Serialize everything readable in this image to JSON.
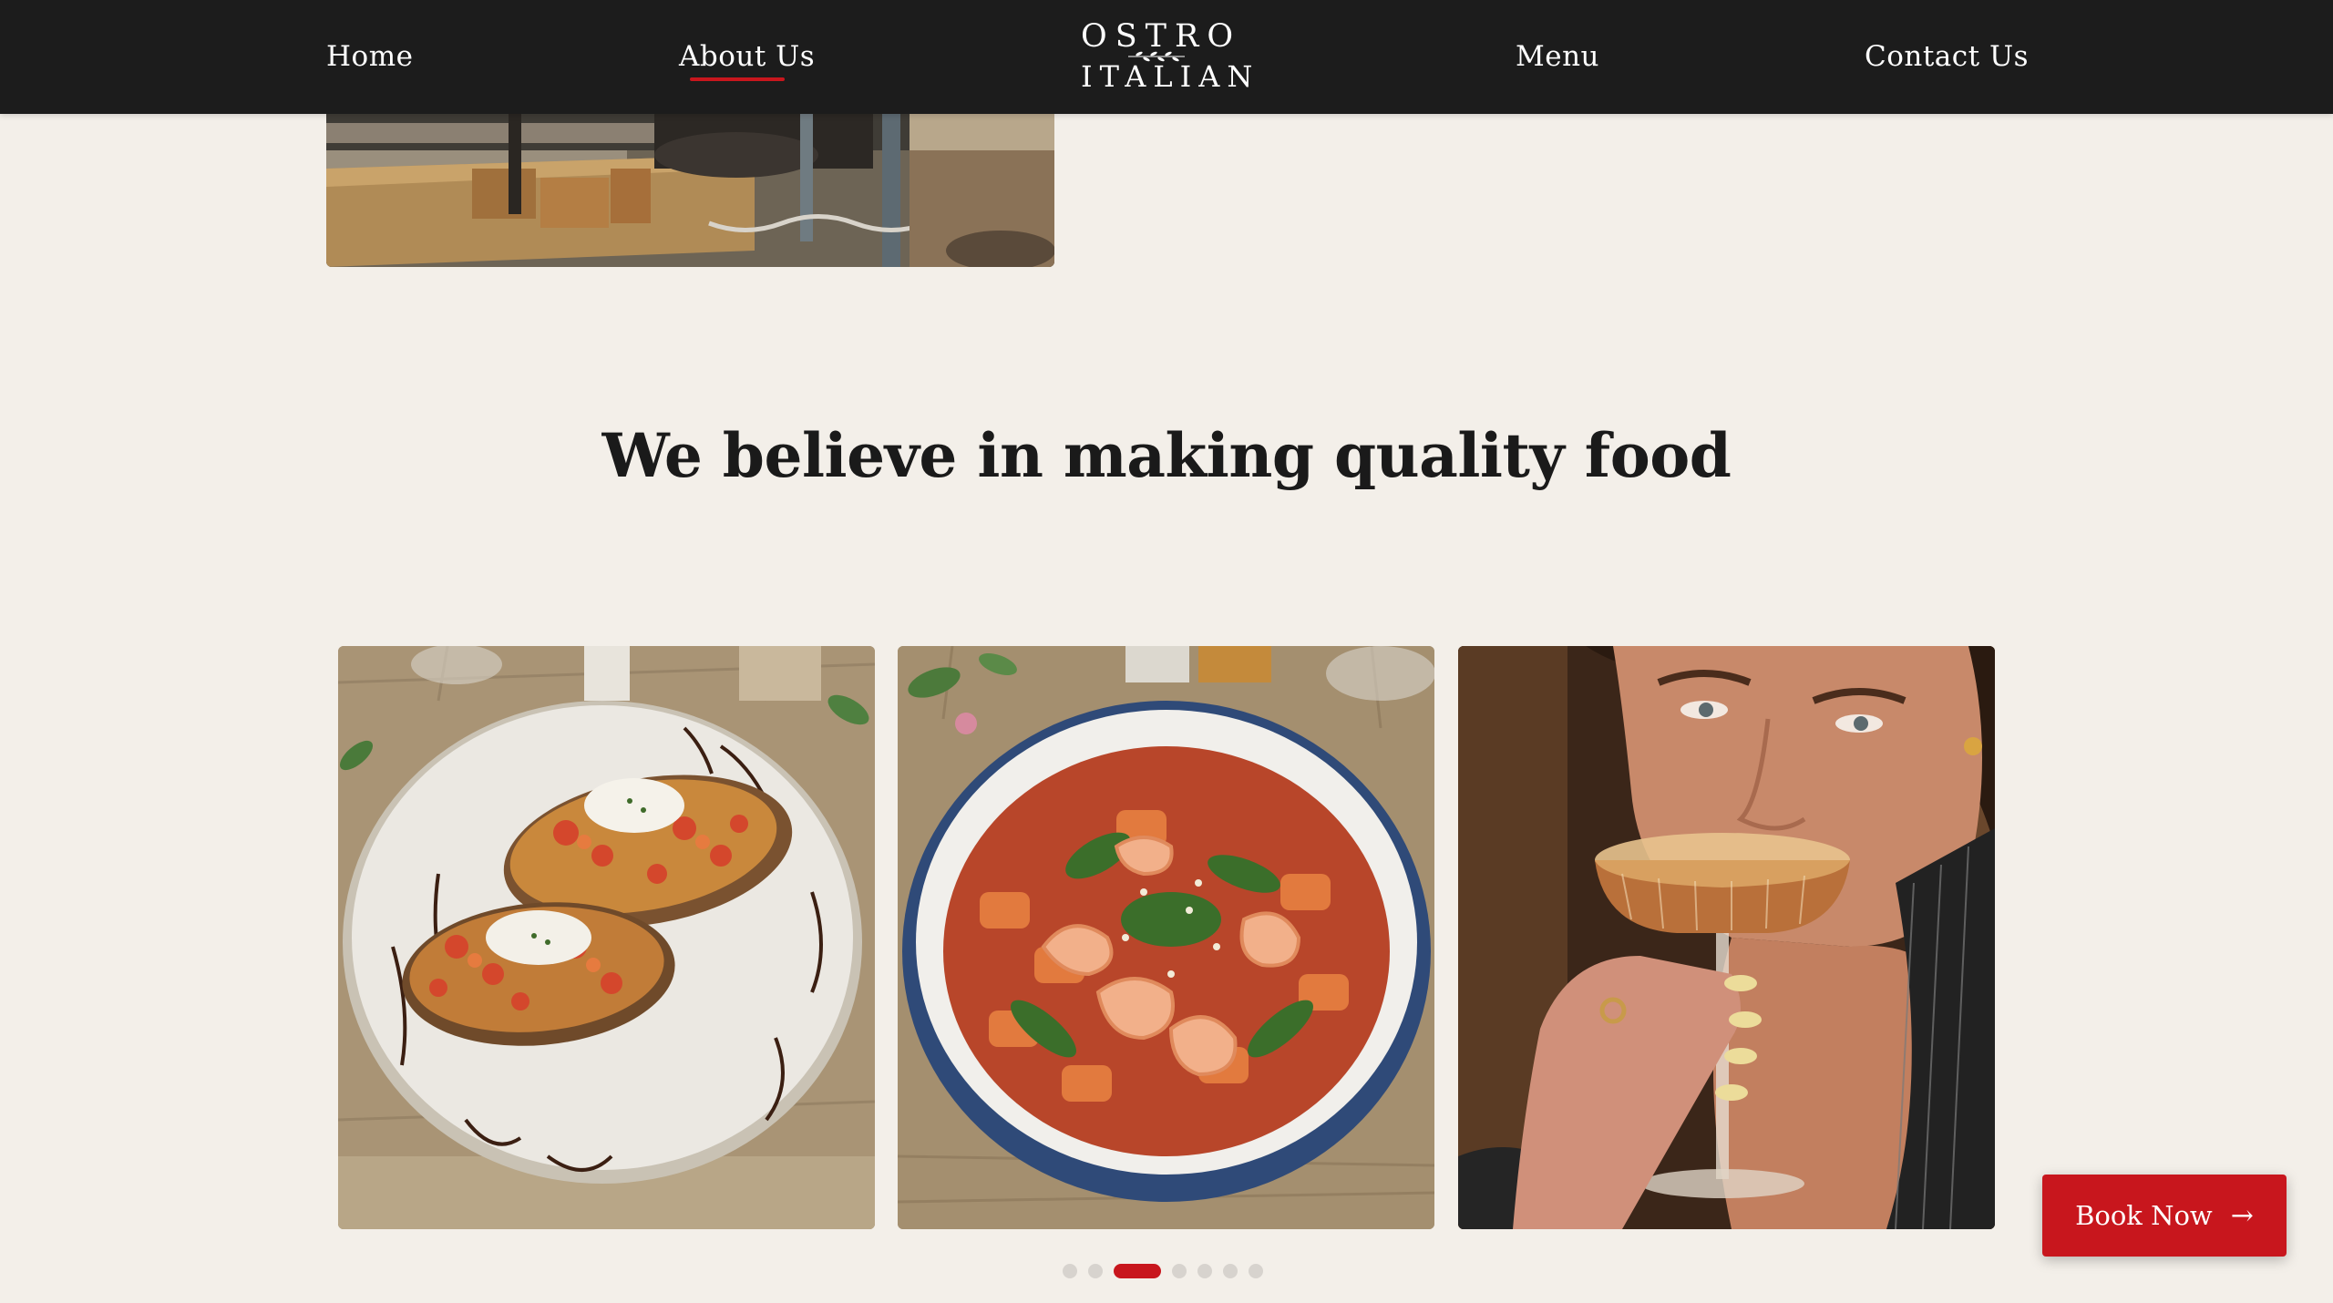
{
  "nav": {
    "home": "Home",
    "about": "About Us",
    "menu": "Menu",
    "contact": "Contact Us",
    "active": "About Us"
  },
  "logo": {
    "line1": "OSTRO",
    "line2": "ITALIAN"
  },
  "section": {
    "title": "We believe in making quality food"
  },
  "carousel": {
    "slides": [
      {
        "subject": "bruschetta with burrata on speckled plate"
      },
      {
        "subject": "gnocchi with prawns and rocket in blue bowl"
      },
      {
        "subject": "woman sipping espresso martini"
      }
    ],
    "dot_count": 7,
    "active_dot_index": 2
  },
  "cta": {
    "label": "Book Now",
    "arrow": "→"
  },
  "colors": {
    "header_bg": "#1c1c1c",
    "page_bg": "#f3efe9",
    "accent_red": "#c8161d",
    "dot_inactive": "#d7d3ce"
  }
}
